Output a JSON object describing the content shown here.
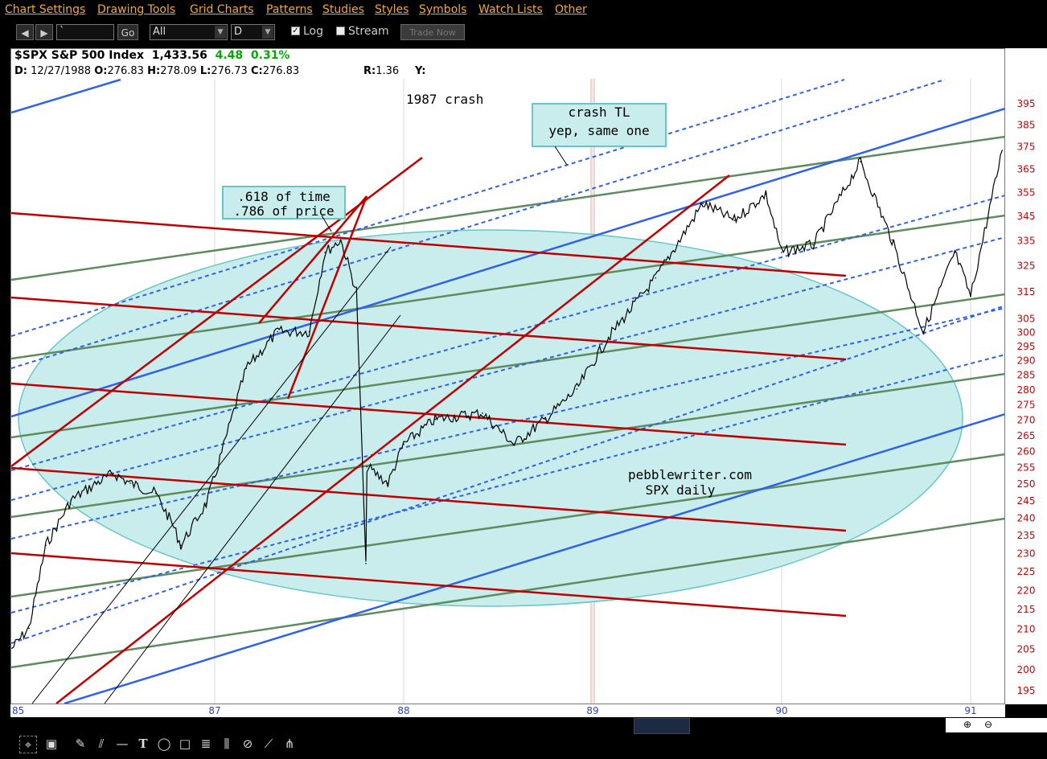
{
  "menu": [
    "Chart Settings",
    "Drawing Tools",
    "Grid Charts",
    "Patterns",
    "Studies",
    "Styles",
    "Symbols",
    "Watch Lists",
    "Other"
  ],
  "toolbar": {
    "symbol_value": "`",
    "go_label": "Go",
    "range_value": "All",
    "period_value": "D",
    "log_label": "Log",
    "log_checked": true,
    "stream_label": "Stream",
    "stream_checked": false,
    "trade_label": "Trade Now"
  },
  "header": {
    "symbol": "$SPX S&P 500 Index",
    "last": "1,433.56",
    "change": "4.48",
    "change_pct": "0.31%",
    "date_label": "D:",
    "date": "12/27/1988",
    "open_label": "O:",
    "open": "276.83",
    "high_label": "H:",
    "high": "278.09",
    "low_label": "L:",
    "low": "276.73",
    "close_label": "C:",
    "close": "276.83",
    "r_label": "R:",
    "r_value": "1.36",
    "y_label": "Y:"
  },
  "chart_data": {
    "type": "line",
    "scale": "log",
    "grid": true,
    "y_ticks": [
      395,
      385,
      375,
      365,
      355,
      345,
      335,
      325,
      315,
      305,
      300,
      295,
      290,
      285,
      280,
      275,
      270,
      265,
      260,
      255,
      250,
      245,
      240,
      235,
      230,
      225,
      220,
      215,
      210,
      205,
      200,
      195
    ],
    "x_ticks": [
      "85",
      "87",
      "88",
      "89",
      "90",
      "91"
    ],
    "annotations": {
      "crash_label": "1987 crash",
      "fib_box_line1": ".618 of time",
      "fib_box_line2": ".786 of price",
      "tl_box_line1": "crash TL",
      "tl_box_line2": "yep, same one",
      "watermark_line1": "pebblewriter.com",
      "watermark_line2": "SPX daily"
    },
    "series": [
      {
        "x": [
          "1985-01",
          "1985-03",
          "1985-05",
          "1985-08",
          "1985-11",
          "1986-01",
          "1986-03",
          "1986-06",
          "1986-08",
          "1986-09",
          "1986-12",
          "1987-01",
          "1987-03",
          "1987-05",
          "1987-07",
          "1987-08",
          "1987-09",
          "1987-10",
          "1987-10-19",
          "1987-10-21",
          "1987-12",
          "1988-01",
          "1988-03",
          "1988-06",
          "1988-08",
          "1988-10",
          "1988-12",
          "1989-02",
          "1989-05",
          "1989-08",
          "1989-10",
          "1989-12",
          "1990-01",
          "1990-03",
          "1990-06",
          "1990-08",
          "1990-10",
          "1990-12",
          "1991-01",
          "1991-03"
        ],
        "y": [
          205,
          210,
          232,
          245,
          250,
          253,
          250,
          247,
          238,
          232,
          244,
          252,
          287,
          300,
          300,
          330,
          335,
          315,
          227,
          255,
          250,
          262,
          270,
          272,
          262,
          270,
          280,
          298,
          320,
          350,
          343,
          354,
          330,
          333,
          368,
          335,
          300,
          330,
          313,
          373
        ]
      }
    ],
    "colors": {
      "price": "#000000",
      "red_lines": "#c00000",
      "blue_lines": "#2f62e6",
      "green_lines": "#5e8c5e",
      "ellipse_fill": "#c9ecec",
      "ellipse_stroke": "#67c6c6",
      "axis_labels": "#cc0000",
      "date_labels": "#2a46c8",
      "change": "#00aa00"
    }
  }
}
